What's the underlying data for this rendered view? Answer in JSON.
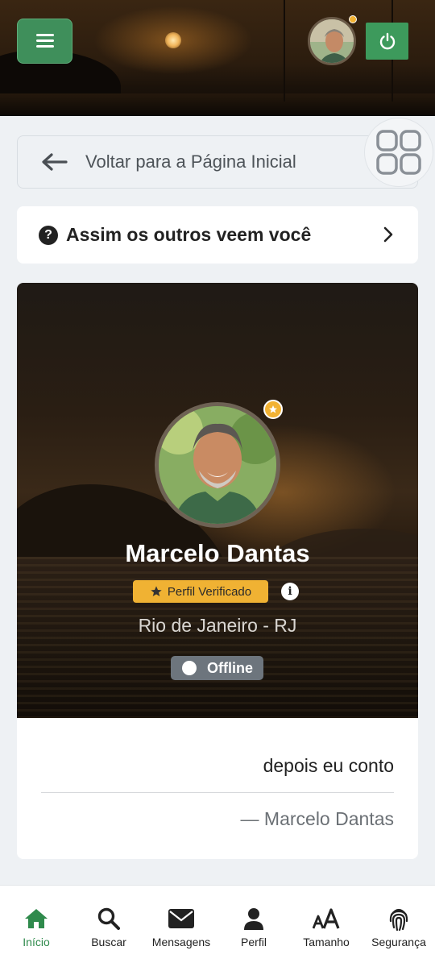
{
  "header": {
    "menu_icon": "hamburger-icon",
    "power_icon": "power-icon",
    "avatar_status_color": "#f2b233",
    "accent_color": "#3f8f5b"
  },
  "back_bar": {
    "label": "Voltar para a Página Inicial",
    "icon": "arrow-left-icon"
  },
  "grid_button": {
    "icon": "grid-icon"
  },
  "others_card": {
    "label": "Assim os outros veem você",
    "icon": "question-circle-icon",
    "chevron": "chevron-right-icon"
  },
  "profile": {
    "name": "Marcelo Dantas",
    "verified_label": "Perfil Verificado",
    "info_glyph": "i",
    "location": "Rio de Janeiro - RJ",
    "status": "Offline",
    "quote": "depois eu conto",
    "quote_author": "— Marcelo Dantas",
    "verified_color": "#f0b233"
  },
  "bottom_nav": {
    "items": [
      {
        "label": "Início",
        "icon": "home-icon",
        "active": true
      },
      {
        "label": "Buscar",
        "icon": "search-icon"
      },
      {
        "label": "Mensagens",
        "icon": "envelope-icon"
      },
      {
        "label": "Perfil",
        "icon": "user-icon"
      },
      {
        "label": "Tamanho",
        "icon": "font-size-icon"
      },
      {
        "label": "Segurança",
        "icon": "fingerprint-icon"
      }
    ],
    "active_color": "#2f8a4c"
  }
}
